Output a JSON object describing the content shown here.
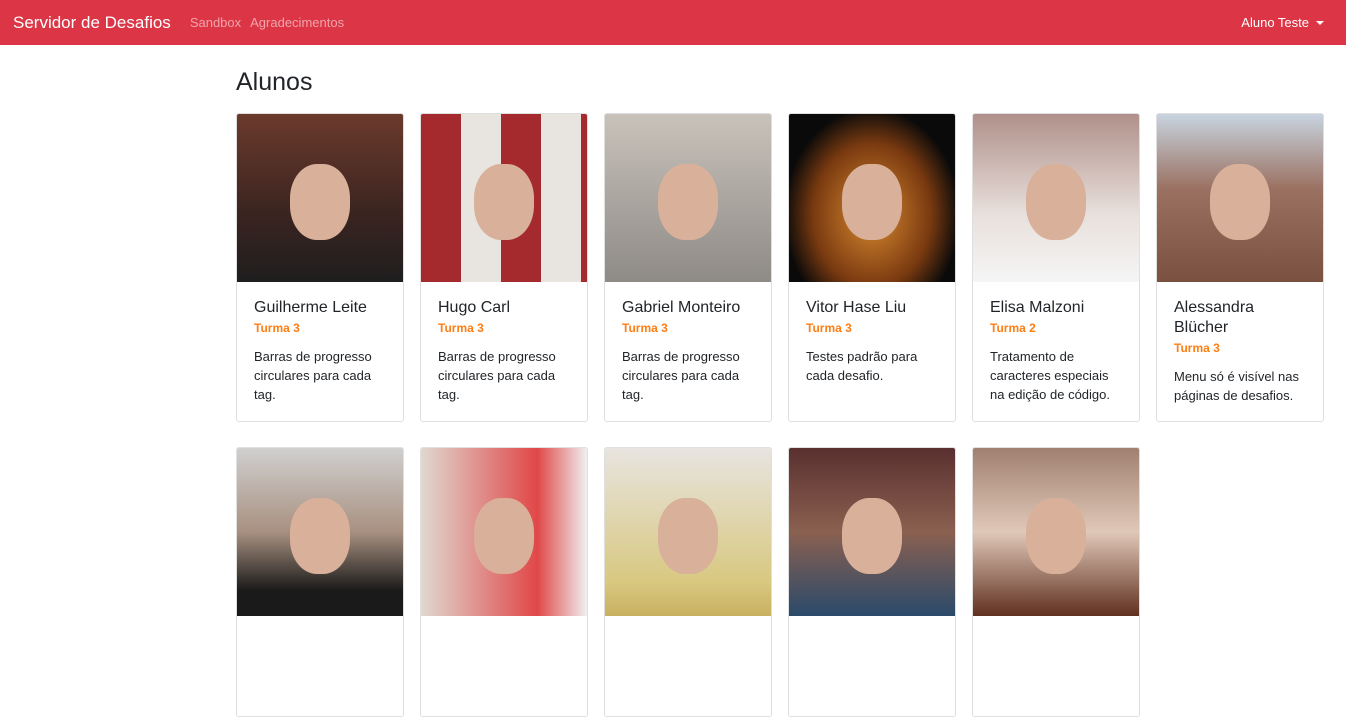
{
  "navbar": {
    "brand": "Servidor de Desafios",
    "links": [
      "Sandbox",
      "Agradecimentos"
    ],
    "user": "Aluno Teste"
  },
  "page_title": "Alunos",
  "students": [
    {
      "name": "Guilherme Leite",
      "turma": "Turma 3",
      "desc": "Barras de progresso circulares para cada tag.",
      "bg": "linear-gradient(#6b3a2c,#3a2420 60%,#1e1e1e)"
    },
    {
      "name": "Hugo Carl",
      "turma": "Turma 3",
      "desc": "Barras de progresso circulares para cada tag.",
      "bg": "repeating-linear-gradient(90deg,#a42a2e 0 40px,#e8e4e0 40px 80px)"
    },
    {
      "name": "Gabriel Monteiro",
      "turma": "Turma 3",
      "desc": "Barras de progresso circulares para cada tag.",
      "bg": "linear-gradient(#c8c2ba,#8e8a86)"
    },
    {
      "name": "Vitor Hase Liu",
      "turma": "Turma 3",
      "desc": "Testes padrão para cada desafio.",
      "bg": "radial-gradient(ellipse at 50% 60%,#d98a30,#7a3a10 50%,#0a0a0a 75%)"
    },
    {
      "name": "Elisa Malzoni",
      "turma": "Turma 2",
      "desc": "Tratamento de caracteres especiais na edição de código.",
      "bg": "linear-gradient(#b0908a,#e8e0dc 60%,#f5f5f5)"
    },
    {
      "name": "Alessandra Blücher",
      "turma": "Turma 3",
      "desc": "Menu só é visível nas páginas de desafios.",
      "bg": "linear-gradient(#c8d4e0,#9a7060 45%,#7a5040)"
    },
    {
      "bg": "linear-gradient(#d0d0d0,#a89080 50%,#1a1a1a 85%)"
    },
    {
      "bg": "linear-gradient(90deg,#e0d8d0,#e04848 70%,#f0f0f0)"
    },
    {
      "bg": "linear-gradient(#e8e4e0,#d8c880 80%,#c8b060)"
    },
    {
      "bg": "linear-gradient(#5a3030,#8a6050 50%,#2a4a6a)"
    },
    {
      "bg": "linear-gradient(#a08070,#e0c8b8 50%,#603020)"
    }
  ]
}
